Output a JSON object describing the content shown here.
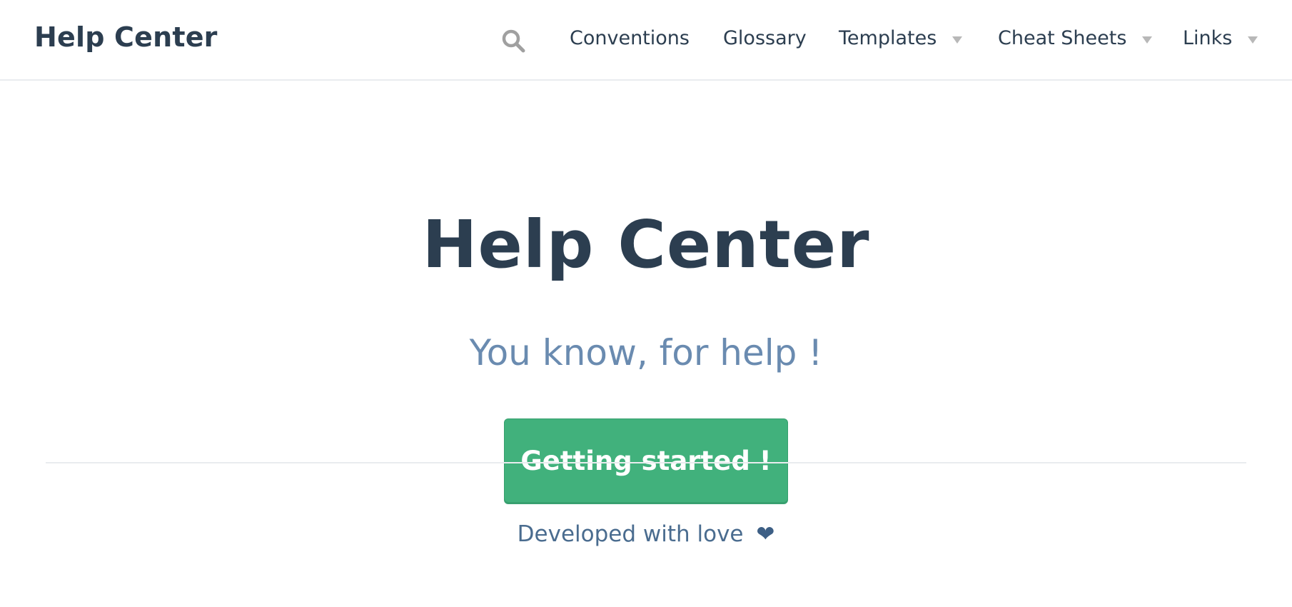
{
  "navbar": {
    "brand": "Help Center",
    "search_icon": "search-icon",
    "items": [
      {
        "label": "Conventions",
        "dropdown": false
      },
      {
        "label": "Glossary",
        "dropdown": false
      },
      {
        "label": "Templates",
        "dropdown": true
      },
      {
        "label": "Cheat Sheets",
        "dropdown": true
      },
      {
        "label": "Links",
        "dropdown": true
      }
    ]
  },
  "hero": {
    "title": "Help Center",
    "subtitle": "You know, for help !",
    "cta_label": "Getting started !"
  },
  "footer": {
    "text": "Developed with love",
    "heart": "❤"
  },
  "colors": {
    "text_dark": "#2c3e50",
    "subtitle": "#6a8bb0",
    "button_green": "#41b17c",
    "caret_gray": "#b8b8b8",
    "divider": "#e9ecef"
  }
}
